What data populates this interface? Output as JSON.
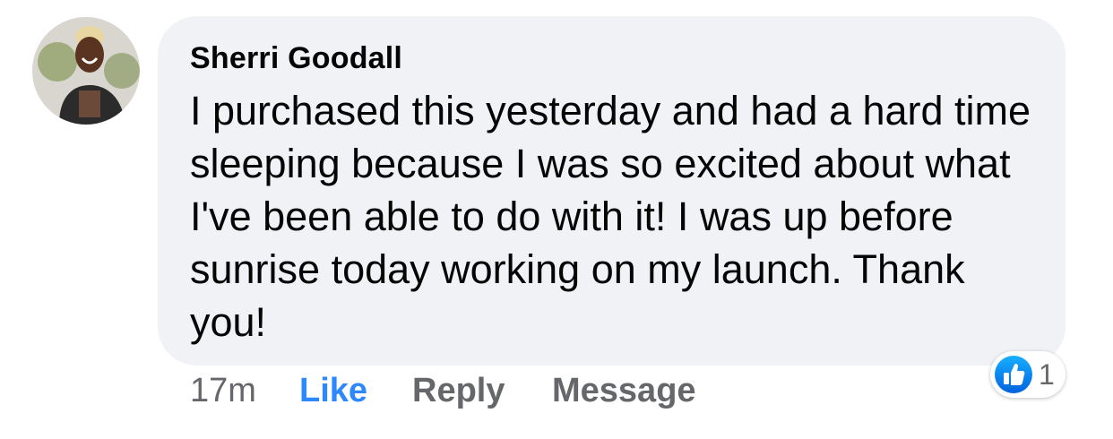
{
  "comment": {
    "author": "Sherri Goodall",
    "text": "I purchased this yesterday and had a hard time sleeping because I was so excited about what I've been able to do with it! I was up before sunrise today working on my launch. Thank you!",
    "timestamp": "17m",
    "actions": {
      "like": "Like",
      "reply": "Reply",
      "message": "Message"
    },
    "reactions": {
      "icon": "thumbs-up-icon",
      "count": "1"
    }
  },
  "colors": {
    "bubble": "#f0f2f5",
    "like_blue": "#2d88ff",
    "secondary_text": "#65676b"
  }
}
